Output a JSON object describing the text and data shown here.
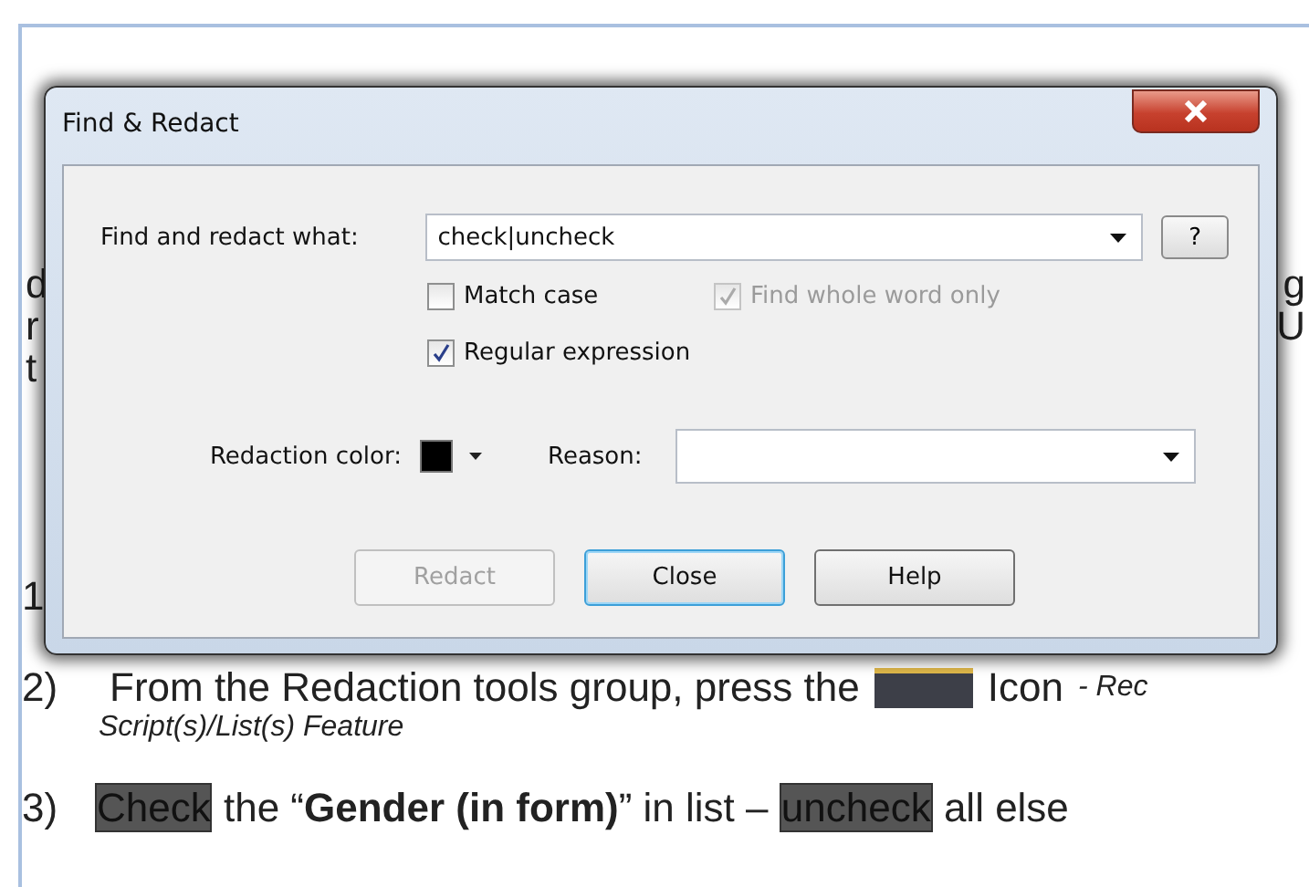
{
  "document": {
    "lines": [
      {
        "left": "d",
        "right": "g"
      },
      {
        "left": "r",
        "right": "U"
      },
      {
        "left": "t"
      }
    ],
    "step_1": {
      "number": "1"
    },
    "step_2": {
      "number": "2)",
      "text": "From the Redaction tools group, press the",
      "icon_word": "Icon",
      "note": "- Rec",
      "subnote": "Script(s)/List(s) Feature"
    },
    "step_3": {
      "number": "3)",
      "segments": [
        {
          "text": "Check",
          "highlighted": true
        },
        {
          "text": " the “**Gender (in form)**” in list – ",
          "highlighted": false
        },
        {
          "text": "uncheck",
          "highlighted": true
        },
        {
          "text": " all else",
          "highlighted": false
        }
      ]
    }
  },
  "dialog": {
    "title": "Find & Redact",
    "find_label": "Find and redact what:",
    "find_value": "check|uncheck",
    "help_symbol": "?",
    "options": [
      {
        "label": "Match case",
        "checked": false,
        "disabled": false
      },
      {
        "label": "Find whole word only",
        "checked": true,
        "disabled": true
      },
      {
        "label": "Regular expression",
        "checked": true,
        "disabled": false
      }
    ],
    "color_label": "Redaction color:",
    "reason_label": "Reason:",
    "buttons": [
      {
        "label": "Redact",
        "disabled": true,
        "default": false
      },
      {
        "label": "Close",
        "disabled": false,
        "default": true
      },
      {
        "label": "Help",
        "disabled": false,
        "default": false
      }
    ]
  }
}
